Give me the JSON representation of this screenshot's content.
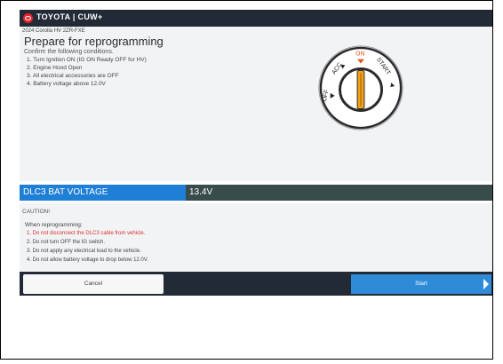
{
  "app": {
    "brand": "TOYOTA | CUW+"
  },
  "vehicle": "2024 Corolla HV 2ZR-FXE",
  "title": "Prepare for reprogramming",
  "subtitle": "Confirm the following conditions.",
  "conditions": [
    "1. Turn Ignition ON (IG ON Ready OFF for HV)",
    "2. Engine Hood Open",
    "3. All electrical accessories are OFF",
    "4. Battery voltage above 12.0V"
  ],
  "ignition": {
    "off": "OFF",
    "acc": "ACC",
    "on": "ON",
    "start": "START",
    "active_color": "#e8521d"
  },
  "voltage": {
    "label": "DLC3 BAT VOLTAGE",
    "value": "13.4V"
  },
  "caution": {
    "title": "CAUTION!",
    "intro": "When reprogramming:",
    "items": [
      "1. Do not disconnect the DLC3 cable from vehicle.",
      "2. Do not turn OFF the IG switch.",
      "3. Do not apply any electrical load to the vehicle.",
      "4. Do not allow battery voltage to drop below 12.0V."
    ]
  },
  "buttons": {
    "cancel": "Cancel",
    "start": "Start"
  },
  "colors": {
    "header": "#222a36",
    "accent": "#1f7fd6",
    "warning": "#d9302a"
  }
}
